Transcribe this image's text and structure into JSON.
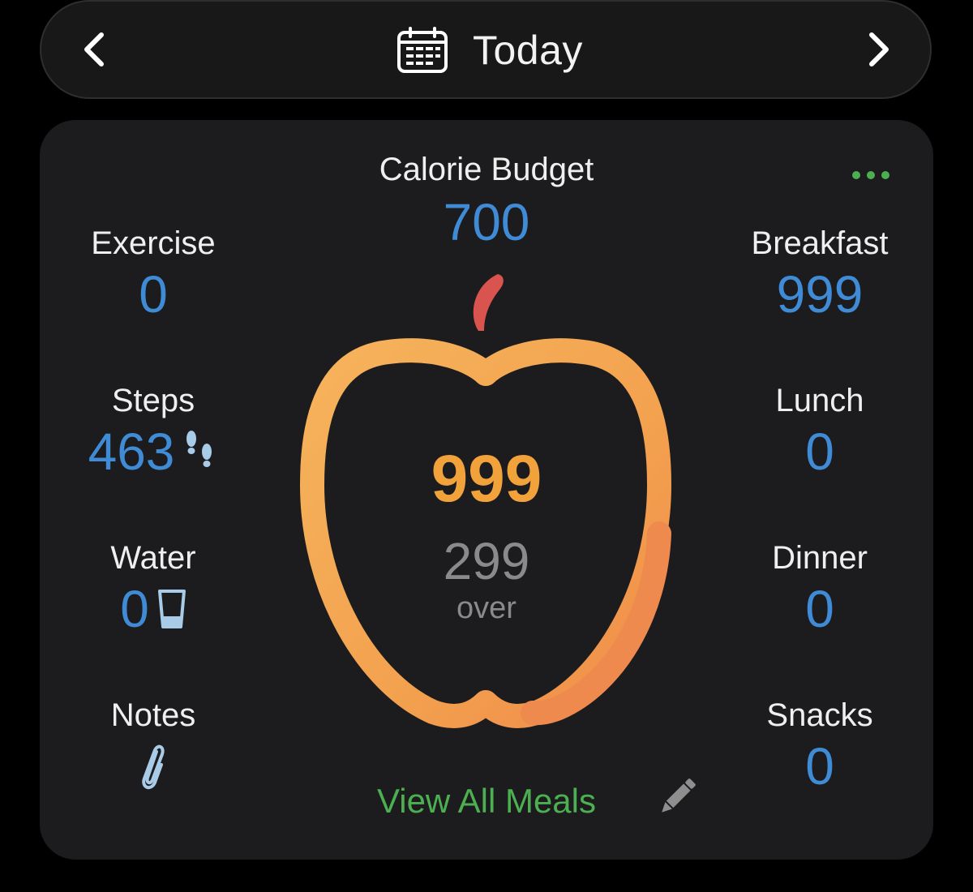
{
  "header": {
    "title": "Today",
    "prev_icon": "chevron-left-icon",
    "next_icon": "chevron-right-icon",
    "calendar_icon": "calendar-icon"
  },
  "summary": {
    "budget_label": "Calorie Budget",
    "budget_value": "700",
    "more_icon": "more-dots-icon",
    "eaten": "999",
    "remaining": "299",
    "remaining_status": "over",
    "view_all_meals": "View All Meals",
    "edit_icon": "pencil-icon"
  },
  "left_stats": {
    "exercise": {
      "label": "Exercise",
      "value": "0"
    },
    "steps": {
      "label": "Steps",
      "value": "463",
      "icon": "footsteps-icon"
    },
    "water": {
      "label": "Water",
      "value": "0",
      "icon": "glass-icon"
    },
    "notes": {
      "label": "Notes",
      "icon": "paperclip-icon"
    }
  },
  "meals": {
    "breakfast": {
      "label": "Breakfast",
      "value": "999"
    },
    "lunch": {
      "label": "Lunch",
      "value": "0"
    },
    "dinner": {
      "label": "Dinner",
      "value": "0"
    },
    "snacks": {
      "label": "Snacks",
      "value": "0"
    }
  },
  "colors": {
    "accent_blue": "#3f8bd6",
    "accent_green": "#4caf50",
    "apple_orange": "#f2a23a",
    "apple_stem": "#d9534f",
    "background": "#000000",
    "card": "#1c1c1e"
  }
}
